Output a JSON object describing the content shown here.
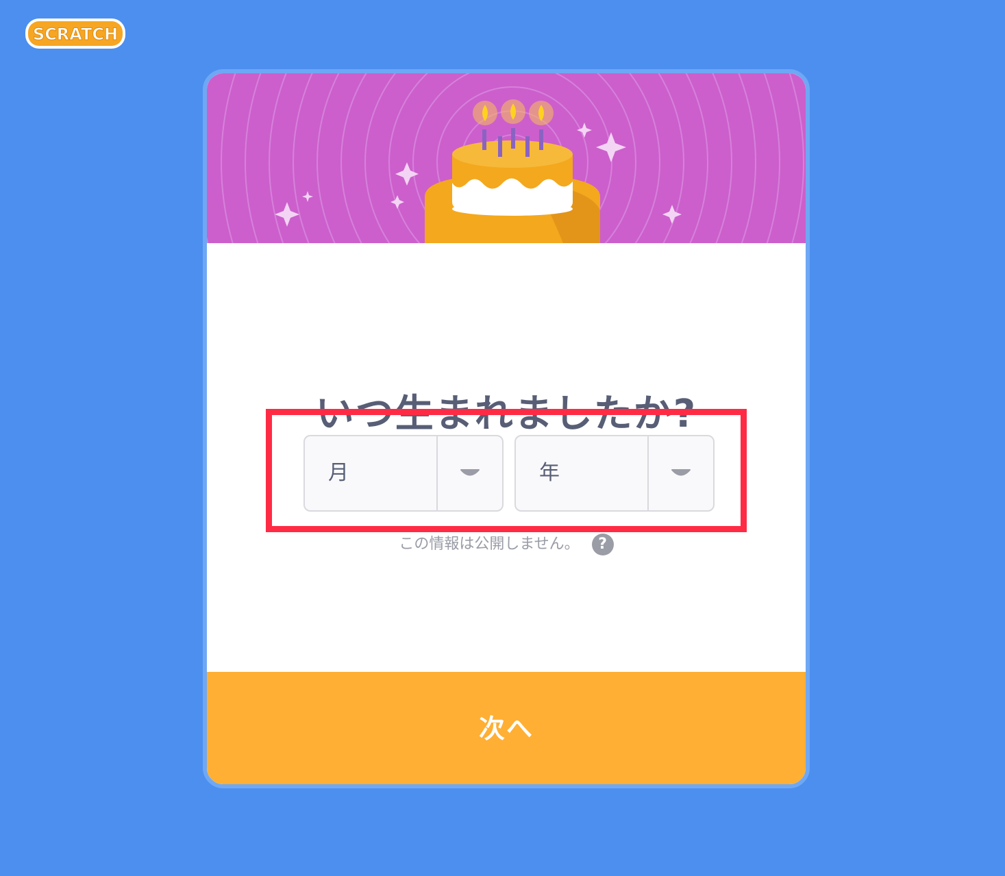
{
  "brand": {
    "logo_text": "SCRATCH"
  },
  "dialog": {
    "title": "いつ生まれましたか?",
    "month_select": {
      "value": "月"
    },
    "year_select": {
      "value": "年"
    },
    "privacy_note": "この情報は公開しません。",
    "help_icon_glyph": "?",
    "next_button_label": "次へ"
  },
  "colors": {
    "background": "#4c8fef",
    "banner": "#cc5fcc",
    "accent_button": "#ffaf33",
    "highlight": "#ff2b45",
    "title_text": "#575e75"
  },
  "icons": {
    "logo": "scratch-logo",
    "help": "question-circle-icon",
    "dropdown": "chevron-down-icon",
    "banner": "birthday-cake-illustration"
  }
}
